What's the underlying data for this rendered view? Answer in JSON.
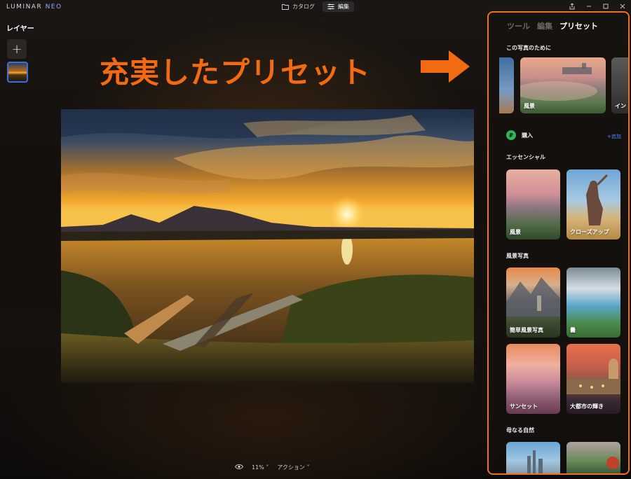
{
  "titlebar": {
    "logo_main": "LUMINAR ",
    "logo_accent": "NEO",
    "tabs": [
      {
        "label": "カタログ",
        "icon": "folder-icon",
        "active": false
      },
      {
        "label": "編集",
        "icon": "sliders-icon",
        "active": true
      }
    ]
  },
  "layers": {
    "title": "レイヤー",
    "add_symbol": "+"
  },
  "headline": "充実したプリセット",
  "bottom_bar": {
    "zoom": "11%",
    "actions": "アクション"
  },
  "panel": {
    "tabs": [
      {
        "label": "ツール",
        "active": false
      },
      {
        "label": "編集",
        "active": false
      },
      {
        "label": "プリセット",
        "active": true
      }
    ],
    "for_this_photo": {
      "title": "この写真のために",
      "cards": [
        {
          "label": "",
          "theme": "partial-blue"
        },
        {
          "label": "風景",
          "theme": "misty-landscape"
        },
        {
          "label": "イン",
          "theme": "interior"
        }
      ]
    },
    "purchased": {
      "label": "購入",
      "add_label": "+追加"
    },
    "essential": {
      "title": "エッセンシャル",
      "cards": [
        {
          "label": "風景",
          "theme": "misty-landscape"
        },
        {
          "label": "クローズアップ",
          "theme": "closeup-sky"
        }
      ]
    },
    "landscape_photo": {
      "title": "風景写真",
      "cards": [
        {
          "label": "簡単風景写真",
          "theme": "mountain"
        },
        {
          "label": "曇",
          "theme": "cloudy"
        },
        {
          "label": "サンセット",
          "theme": "sunset-pink"
        },
        {
          "label": "大都市の輝き",
          "theme": "city-glow"
        }
      ]
    },
    "mother_nature": {
      "title": "母なる自然",
      "cards": [
        {
          "label": "",
          "theme": "city-sky"
        },
        {
          "label": "",
          "theme": "person-field"
        }
      ]
    }
  },
  "colors": {
    "accent_orange": "#f26a12",
    "frame_orange": "#f0701c",
    "link_blue": "#4a86ff",
    "buy_green": "#2fb45a",
    "layer_selected": "#3e6fd6"
  }
}
